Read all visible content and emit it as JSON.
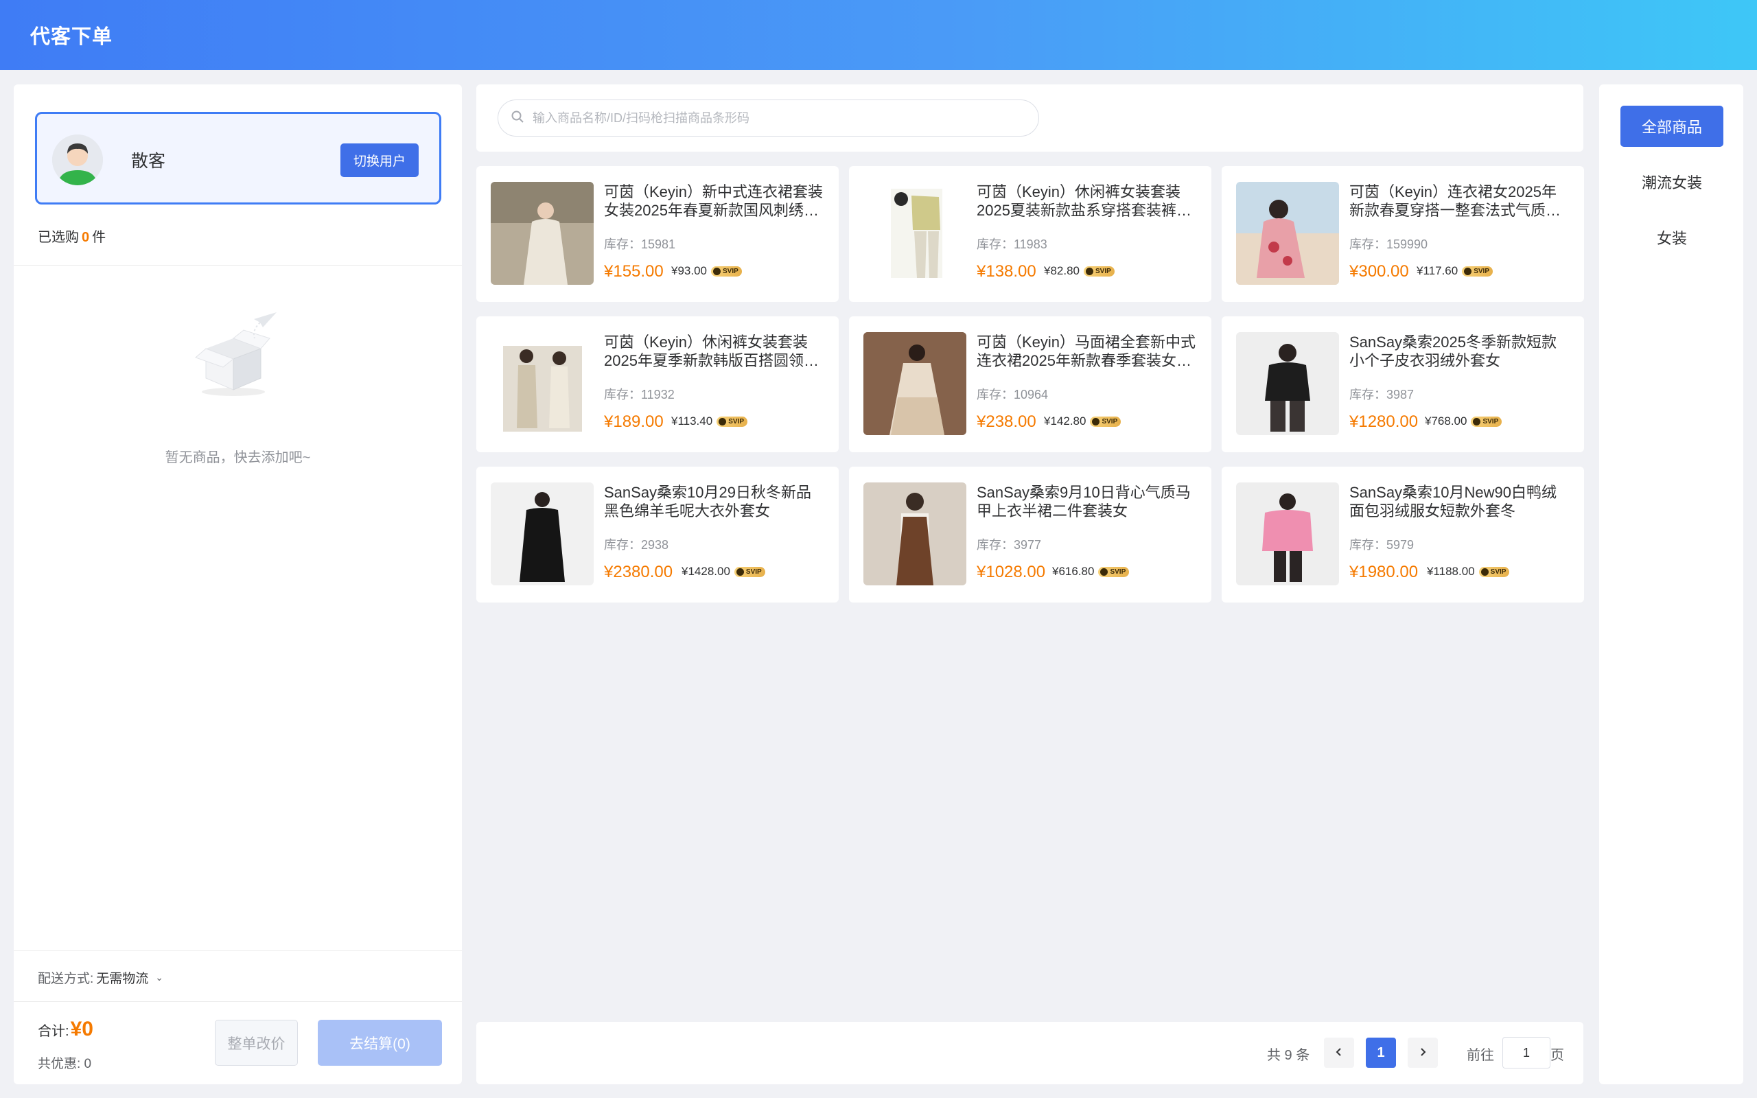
{
  "header": {
    "title": "代客下单"
  },
  "customer": {
    "name": "散客",
    "switch_label": "切换用户"
  },
  "cart": {
    "selected_prefix": "已选购",
    "selected_count": "0",
    "selected_suffix": "件",
    "empty_text": "暂无商品，快去添加吧~",
    "delivery_label": "配送方式:",
    "delivery_value": "无需物流",
    "total_label": "合计:",
    "total_amount": "¥0",
    "discount_label": "共优惠: 0",
    "adjust_label": "整单改价",
    "checkout_label": "去结算(0)"
  },
  "search": {
    "placeholder": "输入商品名称/ID/扫码枪扫描商品条形码"
  },
  "products": [
    {
      "name": "可茵（Keyin）新中式连衣裙套装女装2025年春夏新款国风刺绣温柔…",
      "stock": "库存：15981",
      "price": "¥155.00",
      "vip_price": "¥93.00",
      "badge": "SVIP"
    },
    {
      "name": "可茵（Keyin）休闲裤女装套装2025夏装新款盐系穿搭套装裤小…",
      "stock": "库存：11983",
      "price": "¥138.00",
      "vip_price": "¥82.80",
      "badge": "SVIP"
    },
    {
      "name": "可茵（Keyin）连衣裙女2025年新款春夏穿搭一整套法式气质开衫…",
      "stock": "库存：159990",
      "price": "¥300.00",
      "vip_price": "¥117.60",
      "badge": "SVIP"
    },
    {
      "name": "可茵（Keyin）休闲裤女装套装2025年夏季新款韩版百搭圆领短…",
      "stock": "库存：11932",
      "price": "¥189.00",
      "vip_price": "¥113.40",
      "badge": "SVIP"
    },
    {
      "name": "可茵（Keyin）马面裙全套新中式连衣裙2025年新款春季套装女国…",
      "stock": "库存：10964",
      "price": "¥238.00",
      "vip_price": "¥142.80",
      "badge": "SVIP"
    },
    {
      "name": "SanSay桑索2025冬季新款短款小个子皮衣羽绒外套女",
      "stock": "库存：3987",
      "price": "¥1280.00",
      "vip_price": "¥768.00",
      "badge": "SVIP"
    },
    {
      "name": "SanSay桑索10月29日秋冬新品黑色绵羊毛呢大衣外套女",
      "stock": "库存：2938",
      "price": "¥2380.00",
      "vip_price": "¥1428.00",
      "badge": "SVIP"
    },
    {
      "name": "SanSay桑索9月10日背心气质马甲上衣半裙二件套装女",
      "stock": "库存：3977",
      "price": "¥1028.00",
      "vip_price": "¥616.80",
      "badge": "SVIP"
    },
    {
      "name": "SanSay桑索10月New90白鸭绒面包羽绒服女短款外套冬",
      "stock": "库存：5979",
      "price": "¥1980.00",
      "vip_price": "¥1188.00",
      "badge": "SVIP"
    }
  ],
  "pagination": {
    "total": "共 9 条",
    "prev_icon": "chevron-left-icon",
    "current_page": "1",
    "next_icon": "chevron-right-icon",
    "goto_label": "前往",
    "goto_value": "1",
    "goto_unit": "页"
  },
  "categories": [
    {
      "label": "全部商品",
      "active": true
    },
    {
      "label": "潮流女装",
      "active": false
    },
    {
      "label": "女装",
      "active": false
    }
  ],
  "colors": {
    "accent": "#3f6fe8",
    "price": "#f57a00",
    "header_start": "#3f7cf5",
    "header_end": "#3ec7f7"
  }
}
